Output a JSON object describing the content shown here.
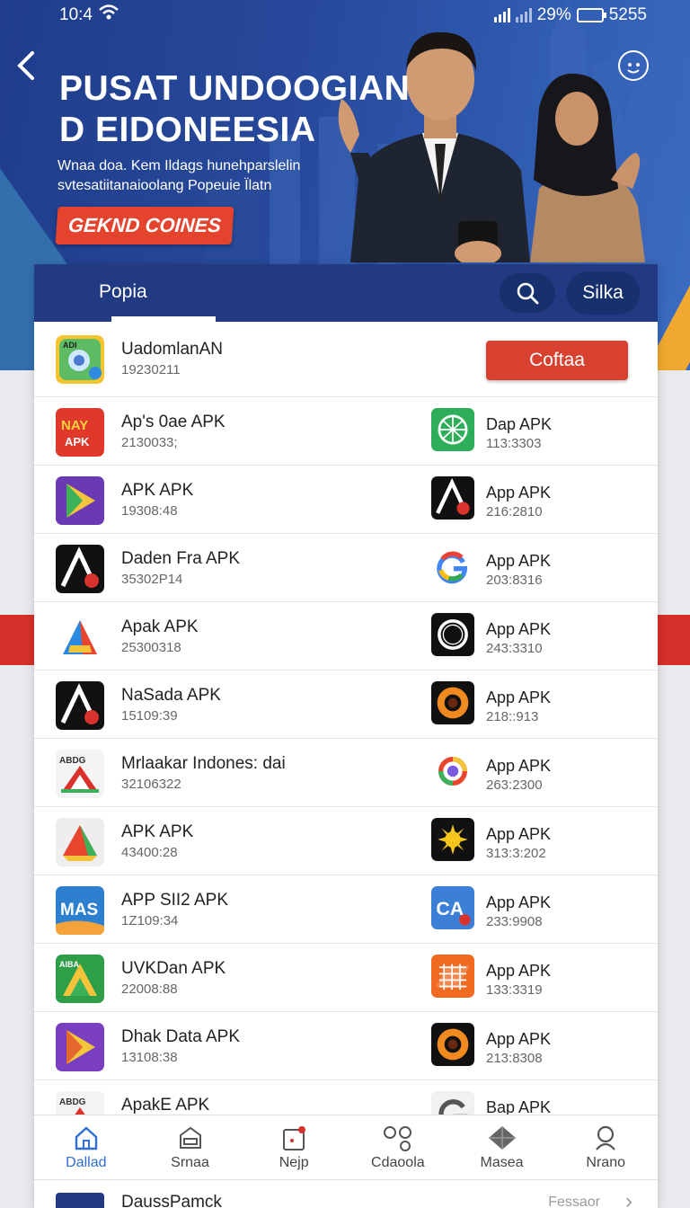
{
  "status_bar": {
    "time": "10:4",
    "battery": "29%",
    "extra": "5255"
  },
  "hero": {
    "title_line1": "PUSAT UNDOOGIAN",
    "title_line2": "D EIDONEESIA",
    "subtitle_line1": "Wnaa doa. Kem Ildags hunehparslelin",
    "subtitle_line2": "svtesatiitanaioolang Popeuie Ïlatn",
    "cta_label": "GEKND COINES"
  },
  "tabs": {
    "active": "Popia",
    "silka": "Silka"
  },
  "featured": {
    "name": "UadomlanAN",
    "size": "19230211",
    "button": "Coftaa"
  },
  "rows": [
    {
      "left": {
        "name": "Ap's 0ae APK",
        "size": "2130033;",
        "icon": "nay-apk-icon"
      },
      "right": {
        "name": "Dap APK",
        "size": "113:3303",
        "icon": "green-globe-icon"
      }
    },
    {
      "left": {
        "name": "APK APK",
        "size": "19308:48",
        "icon": "play-store-icon"
      },
      "right": {
        "name": "App APK",
        "size": "216:2810",
        "icon": "black-a-icon"
      }
    },
    {
      "left": {
        "name": "Daden Fra APK",
        "size": "35302P14",
        "icon": "black-a-icon"
      },
      "right": {
        "name": "App APK",
        "size": "203:8316",
        "icon": "google-g-icon"
      }
    },
    {
      "left": {
        "name": "Apak APK",
        "size": "25300318",
        "icon": "colorful-a-icon"
      },
      "right": {
        "name": "App APK",
        "size": "243:3310",
        "icon": "ring-icon"
      }
    },
    {
      "left": {
        "name": "NaSada APK",
        "size": "15109:39",
        "icon": "black-a-icon"
      },
      "right": {
        "name": "App APK",
        "size": "218::913",
        "icon": "orange-ring-icon"
      }
    },
    {
      "left": {
        "name": "Mrlaakar Indones: dai",
        "size": "32106322",
        "icon": "abdg-icon"
      },
      "right": {
        "name": "App APK",
        "size": "263:2300",
        "icon": "color-ring-icon"
      }
    },
    {
      "left": {
        "name": "APK APK",
        "size": "43400:28",
        "icon": "drive-icon"
      },
      "right": {
        "name": "App APK",
        "size": "313:3:202",
        "icon": "sun-icon"
      }
    },
    {
      "left": {
        "name": "APP SII2 APK",
        "size": "1Z109:34",
        "icon": "mas-icon"
      },
      "right": {
        "name": "App APK",
        "size": "233:9908",
        "icon": "ca-icon"
      }
    },
    {
      "left": {
        "name": "UVKDan APK",
        "size": "22008:88",
        "icon": "green-a-icon"
      },
      "right": {
        "name": "App APK",
        "size": "133:3319",
        "icon": "orange-grid-icon"
      }
    },
    {
      "left": {
        "name": "Dhak Data APK",
        "size": "13108:38",
        "icon": "purple-play-icon"
      },
      "right": {
        "name": "App APK",
        "size": "213:8308",
        "icon": "orange-ring-icon"
      }
    },
    {
      "left": {
        "name": "ApakE APK",
        "size": "",
        "icon": "abdg-icon"
      },
      "right": {
        "name": "Bap APK",
        "size": "",
        "icon": "grey-g-icon"
      }
    }
  ],
  "bottom_nav": [
    "Dallad",
    "Srnaa",
    "Nejp",
    "Cdaoola",
    "Masea",
    "Nrano"
  ],
  "peek": {
    "name": "DaussPamck",
    "right": "Fessaor"
  }
}
